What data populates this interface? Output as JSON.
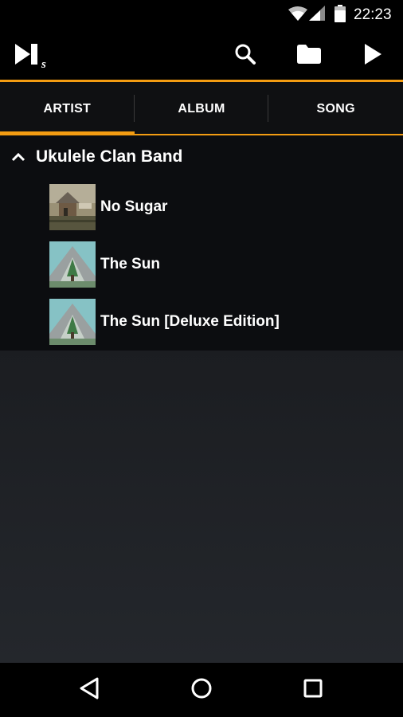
{
  "status_bar": {
    "time": "22:23",
    "icons": [
      "wifi-icon",
      "signal-icon",
      "battery-icon"
    ]
  },
  "app_bar": {
    "logo": "app-logo",
    "actions": [
      "search-icon",
      "folder-icon",
      "play-icon"
    ]
  },
  "tabs": [
    {
      "label": "ARTIST",
      "active": true
    },
    {
      "label": "ALBUM",
      "active": false
    },
    {
      "label": "SONG",
      "active": false
    }
  ],
  "library": {
    "artist": "Ukulele Clan Band",
    "albums": [
      {
        "title": "No Sugar"
      },
      {
        "title": "The Sun"
      },
      {
        "title": "The Sun [Deluxe Edition]"
      }
    ]
  },
  "nav_bar": {
    "buttons": [
      "back-icon",
      "home-icon",
      "recent-apps-icon"
    ]
  },
  "colors": {
    "accent": "#f39c12",
    "background": "#000000",
    "list_background": "#0c0d10"
  }
}
